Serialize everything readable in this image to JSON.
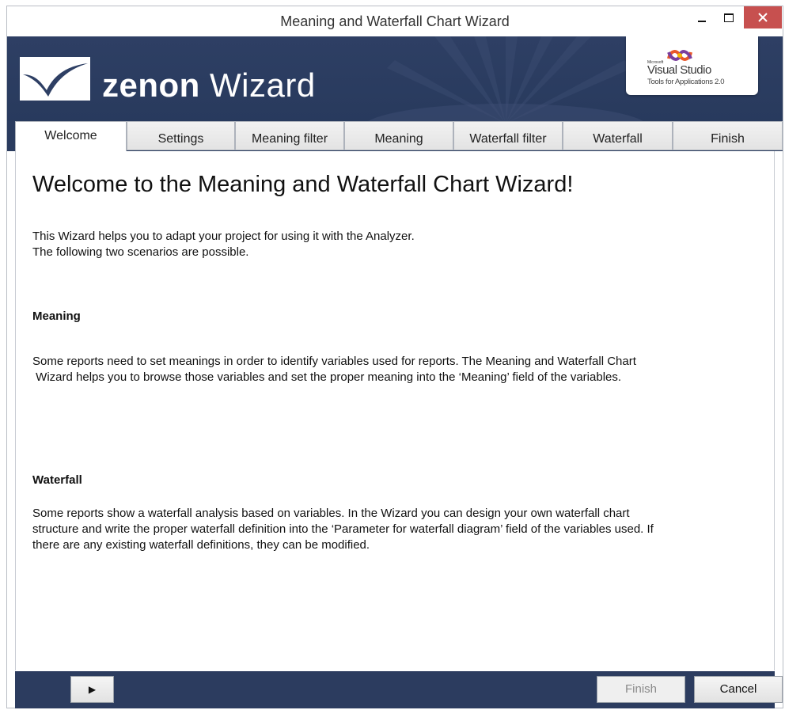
{
  "window": {
    "title": "Meaning and Waterfall Chart Wizard"
  },
  "banner": {
    "brand_bold": "zenon",
    "brand_light": "Wizard",
    "vs_microsoft": "Microsoft",
    "vs_name": "Visual Studio",
    "vs_tools": "Tools for Applications 2.0"
  },
  "tabs": [
    {
      "label": "Welcome",
      "active": true
    },
    {
      "label": "Settings",
      "active": false
    },
    {
      "label": "Meaning filter",
      "active": false
    },
    {
      "label": "Meaning",
      "active": false
    },
    {
      "label": "Waterfall filter",
      "active": false
    },
    {
      "label": "Waterfall",
      "active": false
    },
    {
      "label": "Finish",
      "active": false
    }
  ],
  "content": {
    "title": "Welcome to the Meaning and Waterfall Chart Wizard!",
    "intro_line1": "This  Wizard helps you to adapt your project for using it with the Analyzer.",
    "intro_line2": "The following two scenarios are possible.",
    "meaning_heading": "Meaning",
    "meaning_line1": "Some reports need to set meanings in order to identify variables used for reports. The Meaning and Waterfall Chart",
    "meaning_line2": " Wizard helps you to browse those variables and set the proper meaning into the ‘Meaning’ field of the variables.",
    "waterfall_heading": "Waterfall",
    "waterfall_line1": "Some reports show a waterfall analysis based on variables. In the Wizard you can design your own waterfall chart",
    "waterfall_line2": "structure and write the proper waterfall definition into the ‘Parameter for waterfall diagram’ field of the variables used. If",
    "waterfall_line3": "there are any existing waterfall definitions, they can be modified."
  },
  "footer": {
    "play_glyph": "▶",
    "finish_label": "Finish",
    "cancel_label": "Cancel"
  },
  "colors": {
    "banner": "#2e3f64",
    "close_button": "#c7504f"
  }
}
